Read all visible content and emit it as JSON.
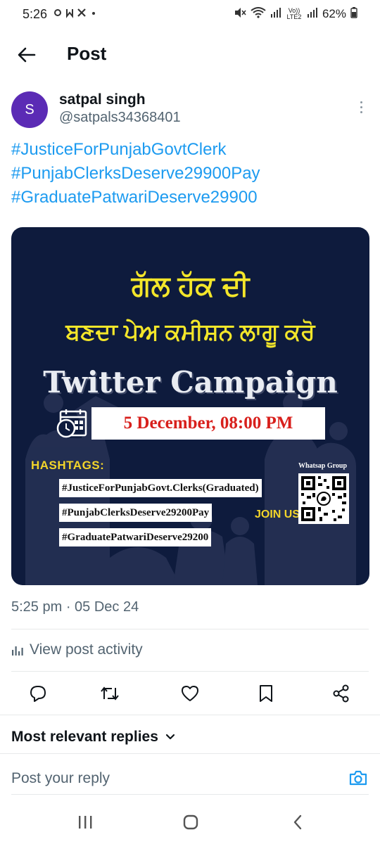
{
  "status_bar": {
    "time": "5:26",
    "network_label": "Vo)) LTE2",
    "battery": "62%"
  },
  "header": {
    "title": "Post"
  },
  "post": {
    "author": {
      "avatar_letter": "S",
      "avatar_color": "#5b2bb5",
      "name": "satpal singh",
      "handle": "@satpals34368401"
    },
    "hashtags": [
      "#JusticeForPunjabGovtClerk",
      "#PunjabClerksDeserve29900Pay",
      "#GraduatePatwariDeserve29900"
    ],
    "image": {
      "line1": "ਗੱਲ ਹੱਕ ਦੀ",
      "line2": "ਬਣਦਾ ਪੇਅ ਕਮੀਸ਼ਨ ਲਾਗੂ ਕਰੋ",
      "campaign": "Twitter Campaign",
      "date": "5 December, 08:00 PM",
      "hashtags_label": "HASHTAGS:",
      "tags": [
        "#JusticeForPunjabGovt.Clerks(Graduated)",
        "#PunjabClerksDeserve29200Pay",
        "#GraduatePatwariDeserve29200"
      ],
      "join_label": "JOIN US:",
      "group_label": "Whatsap Group"
    },
    "timestamp": "5:25 pm · 05 Dec 24",
    "activity_label": "View post activity"
  },
  "replies": {
    "sort_label": "Most relevant replies",
    "reply_placeholder": "Post your reply"
  },
  "colors": {
    "accent": "#1d9bf0",
    "image_bg": "#0e1b3d",
    "image_yellow": "#f3e62a",
    "date_red": "#d8201c"
  },
  "icons": {
    "back": "arrow-left-icon",
    "more": "more-vertical-icon",
    "analytics": "bar-chart-icon",
    "reply": "comment-icon",
    "retweet": "repost-icon",
    "like": "heart-icon",
    "bookmark": "bookmark-icon",
    "share": "share-icon",
    "camera": "camera-icon",
    "sort": "chevron-down-icon"
  }
}
